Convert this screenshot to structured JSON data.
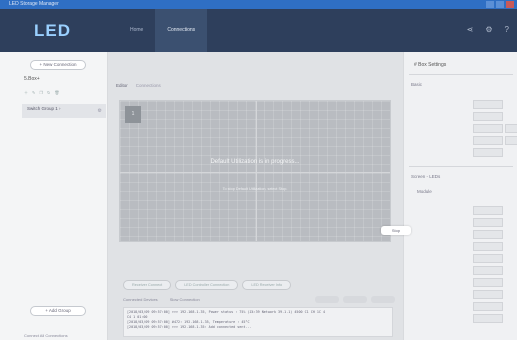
{
  "window": {
    "title": "LED Storage Manager"
  },
  "header": {
    "logo": "LED",
    "tabs": [
      {
        "label": "Home"
      },
      {
        "label": "Connections"
      }
    ]
  },
  "sidebar": {
    "new_connection": "+ New Connection",
    "title": "5.Box+",
    "item_label": "Switch Group 1 ›",
    "add_group": "+ Add Group",
    "footer": "Connect All Connections"
  },
  "main": {
    "tabs": [
      "Editor",
      "Connections"
    ],
    "screen_number": "1",
    "progress_message": "Default Utilization is in progress...",
    "progress_submessage": "To stop Default Utilization, select Stop.",
    "log_filters": [
      "Receiver Connect",
      "LED Controller Connection",
      "LED Receiver Info"
    ],
    "log_tabs": [
      "Connected Devices",
      "Slow Connection"
    ],
    "log_lines": [
      "[2018/03/09 09:57:00] >>> 192.168.1.35, Power status : 75% (Z4:39 Network 39.1.1) 4500 C1 CH 1C 4",
      "C4 1 01:00",
      "[2018/03/09 09:57:00] #472: 192.168.1.35, Temperature : 45°C",
      "[2018/03/09 09:57:00] >>> 192.168.1.35: Add connected sent..."
    ]
  },
  "right_panel": {
    "title": "# Box Settings",
    "section1": "Basic",
    "section2": "Screen - LEDs",
    "section2_sub": "Module",
    "tooltip": "Stop"
  }
}
